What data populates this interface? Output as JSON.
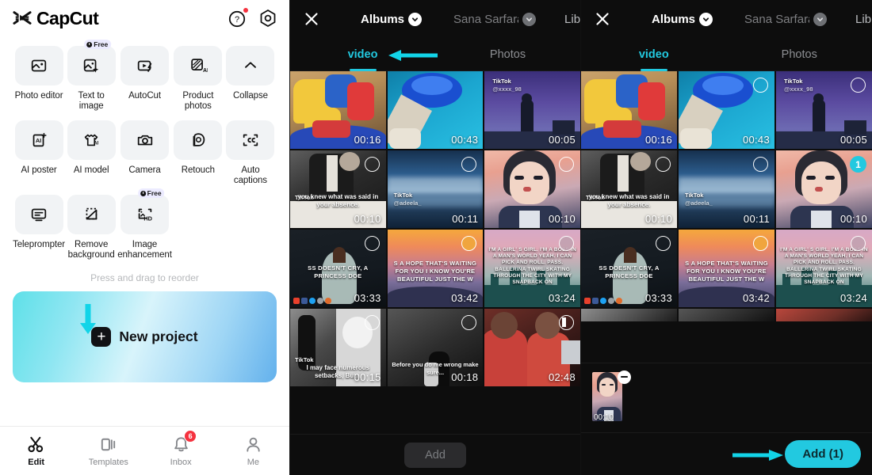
{
  "app": {
    "name": "CapCut",
    "help_icon": "help-circle-icon",
    "settings_icon": "gear-icon"
  },
  "tools": {
    "reorder_hint": "Press and drag to reorder",
    "free_label": "Free",
    "items": [
      {
        "label": "Photo editor",
        "icon": "photo-editor-icon",
        "free": false
      },
      {
        "label": "Text to image",
        "icon": "text-to-image-icon",
        "free": true
      },
      {
        "label": "AutoCut",
        "icon": "autocut-icon",
        "free": false
      },
      {
        "label": "Product photos",
        "icon": "product-photos-icon",
        "free": false
      },
      {
        "label": "Collapse",
        "icon": "chevron-up-icon",
        "free": false
      },
      {
        "label": "AI poster",
        "icon": "ai-poster-icon",
        "free": false
      },
      {
        "label": "AI model",
        "icon": "ai-model-icon",
        "free": false
      },
      {
        "label": "Camera",
        "icon": "camera-icon",
        "free": false
      },
      {
        "label": "Retouch",
        "icon": "retouch-icon",
        "free": false
      },
      {
        "label": "Auto captions",
        "icon": "auto-captions-icon",
        "free": false
      },
      {
        "label": "Teleprompter",
        "icon": "teleprompter-icon",
        "free": false
      },
      {
        "label": "Remove background",
        "icon": "remove-background-icon",
        "free": false
      },
      {
        "label": "Image enhancement",
        "icon": "image-enhancement-icon",
        "free": true
      }
    ]
  },
  "new_project": {
    "label": "New project",
    "plus_icon": "plus-icon",
    "arrow_icon": "down-arrow-annotation"
  },
  "bottom_nav": {
    "items": [
      {
        "label": "Edit",
        "icon": "scissors-icon",
        "active": true,
        "badge": ""
      },
      {
        "label": "Templates",
        "icon": "templates-icon",
        "active": false,
        "badge": ""
      },
      {
        "label": "Inbox",
        "icon": "bell-icon",
        "active": false,
        "badge": "6"
      },
      {
        "label": "Me",
        "icon": "person-icon",
        "active": false,
        "badge": ""
      }
    ]
  },
  "picker": {
    "close_icon": "close-icon",
    "albums_label": "Albums",
    "albums_chevron": "chevron-down-icon",
    "user_label": "Sana Sarfara",
    "user_chevron": "chevron-down-icon",
    "library_label": "Library",
    "tab_video": "video",
    "tab_photos": "Photos",
    "arrow_icon": "left-arrow-annotation",
    "clips": [
      {
        "dur": "00:16",
        "sel": "none",
        "kind": "carousel"
      },
      {
        "dur": "00:43",
        "sel": "none",
        "kind": "bumper-boat"
      },
      {
        "dur": "00:05",
        "sel": "none",
        "kind": "tiktok-dusk",
        "watermark": "TikTok",
        "handle": "@xxxx_98"
      },
      {
        "dur": "00:10",
        "sel": "empty",
        "kind": "suit-man",
        "watermark": "TikTok",
        "caption": "you knew what was said in your absence."
      },
      {
        "dur": "00:11",
        "sel": "empty",
        "kind": "blue-water",
        "watermark": "TikTok",
        "handle": "@adeela_"
      },
      {
        "dur": "00:10",
        "sel": "empty",
        "kind": "anime-boy"
      },
      {
        "dur": "03:33",
        "sel": "empty",
        "kind": "forest-dress",
        "caption": "SS DOESN'T CRY, A PRINCESS DOE"
      },
      {
        "dur": "03:42",
        "sel": "empty",
        "kind": "sunset-lyrics",
        "caption": "S A HOPE THAT'S WAITING FOR YOU I KNOW YOU'RE BEAUTIFUL JUST THE W"
      },
      {
        "dur": "03:24",
        "sel": "empty",
        "kind": "city-lyrics",
        "caption": "I'M A GIRL' S GIRL. I'M A BOSS IN A MAN'S WORLD YEAH. I CAN PICK AND ROLL. PASS. BALLERINA TWIRL SKATING THROUGH THE CITY WITH MY SNAPBACK ON"
      },
      {
        "dur": "00:15",
        "sel": "empty",
        "kind": "bw-anime",
        "watermark": "TikTok",
        "caption": "I may face numerous setbacks, But..."
      },
      {
        "dur": "00:18",
        "sel": "empty",
        "kind": "bw-field",
        "caption": "Before you do me wrong make sure..."
      },
      {
        "dur": "02:48",
        "sel": "half",
        "kind": "boys-red"
      }
    ],
    "add_label": "Add"
  },
  "picker_right": {
    "selected_badge": "1",
    "selected_index": 5,
    "tray": {
      "dur": "00:10",
      "remove_icon": "minus-circle-icon"
    },
    "add_label": "Add (1)",
    "arrow_icon": "right-arrow-annotation"
  }
}
